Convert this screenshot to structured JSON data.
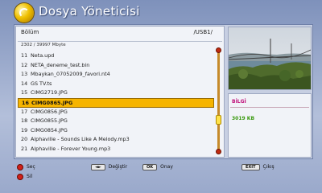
{
  "app": {
    "title": "Dosya Yöneticisi",
    "logo_icon": "swirl-logo-icon"
  },
  "file_panel": {
    "header_label": "Bölüm",
    "path": "/USB1/",
    "storage_info": "2302 / 39997 Mbyte",
    "selected_index": 5,
    "items": [
      {
        "num": "11",
        "name": "Neta.upd"
      },
      {
        "num": "12",
        "name": "NETA_deneme_test.bin"
      },
      {
        "num": "13",
        "name": "Mbaykan_07052009_favori.nt4"
      },
      {
        "num": "14",
        "name": "GS TV.ts"
      },
      {
        "num": "15",
        "name": "CIMG2719.JPG"
      },
      {
        "num": "16",
        "name": "CIMG0865.JPG"
      },
      {
        "num": "17",
        "name": "CIMG0856.JPG"
      },
      {
        "num": "18",
        "name": "CIMG0855.JPG"
      },
      {
        "num": "19",
        "name": "CIMG0854.JPG"
      },
      {
        "num": "20",
        "name": "Alphaville - Sounds Like A Melody.mp3"
      },
      {
        "num": "21",
        "name": "Alphaville - Forever Young.mp3"
      }
    ]
  },
  "info_panel": {
    "title": "BİLGİ",
    "size": "3019 KB"
  },
  "footer": {
    "select": {
      "key": "",
      "label": "Seç"
    },
    "change": {
      "key": "◄►",
      "label": "Değiştir"
    },
    "ok": {
      "key": "OK",
      "label": "Onay"
    },
    "exit": {
      "key": "EXIT",
      "label": "Çıkış"
    },
    "delete": {
      "key": "",
      "label": "Sil"
    }
  },
  "colors": {
    "selection": "#f6b400",
    "info_title": "#c0107a",
    "info_size": "#3a9a10",
    "red_key": "#d0201a"
  }
}
